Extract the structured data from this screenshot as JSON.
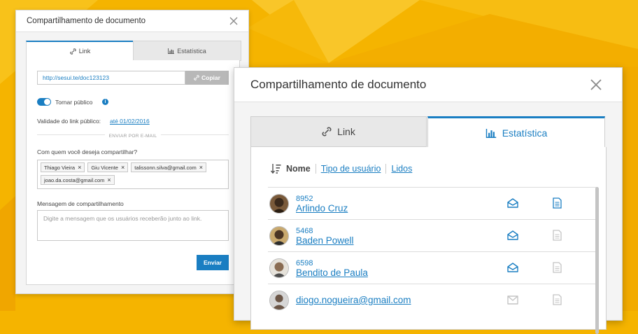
{
  "colors": {
    "accent": "#1a7ec2",
    "background": "#f5b400",
    "muted_icon": "#c4c4c4"
  },
  "small_dialog": {
    "title": "Compartilhamento de documento",
    "tabs": [
      {
        "label": "Link",
        "icon": "link-icon",
        "active": true
      },
      {
        "label": "Estatística",
        "icon": "bar-chart-icon",
        "active": false
      }
    ],
    "link_url": "http://sesui.te/doc123123",
    "copy_label": "Copiar",
    "public_toggle_on": true,
    "public_label": "Tornar público",
    "validity_label": "Validade do link público:",
    "validity_date": "até 01/02/2016",
    "email_divider": "ENVIAR POR E-MAIL",
    "share_question": "Com quem você deseja compartilhar?",
    "recipients": [
      "Thiago Vieira",
      "Giu Vicente",
      "talissonn.silva@gmail.com",
      "joao.da.costa@gmail.com"
    ],
    "message_label": "Mensagem de compartilhamento",
    "message_placeholder": "Digite a mensagem que os usuários receberão junto ao link.",
    "send_label": "Enviar"
  },
  "large_dialog": {
    "title": "Compartilhamento de documento",
    "tabs": [
      {
        "label": "Link",
        "icon": "link-icon",
        "active": false
      },
      {
        "label": "Estatística",
        "icon": "bar-chart-icon",
        "active": true
      }
    ],
    "sort": {
      "active": "Nome",
      "options": [
        "Tipo de usuário",
        "Lidos"
      ]
    },
    "users": [
      {
        "code": "8952",
        "name": "Arlindo Cruz",
        "opened_email": true,
        "read_doc": true
      },
      {
        "code": "5468",
        "name": "Baden Powell",
        "opened_email": true,
        "read_doc": false
      },
      {
        "code": "6598",
        "name": "Bendito de Paula",
        "opened_email": true,
        "read_doc": false
      },
      {
        "code": "",
        "name": "diogo.nogueira@gmail.com",
        "opened_email": false,
        "read_doc": false
      }
    ]
  }
}
